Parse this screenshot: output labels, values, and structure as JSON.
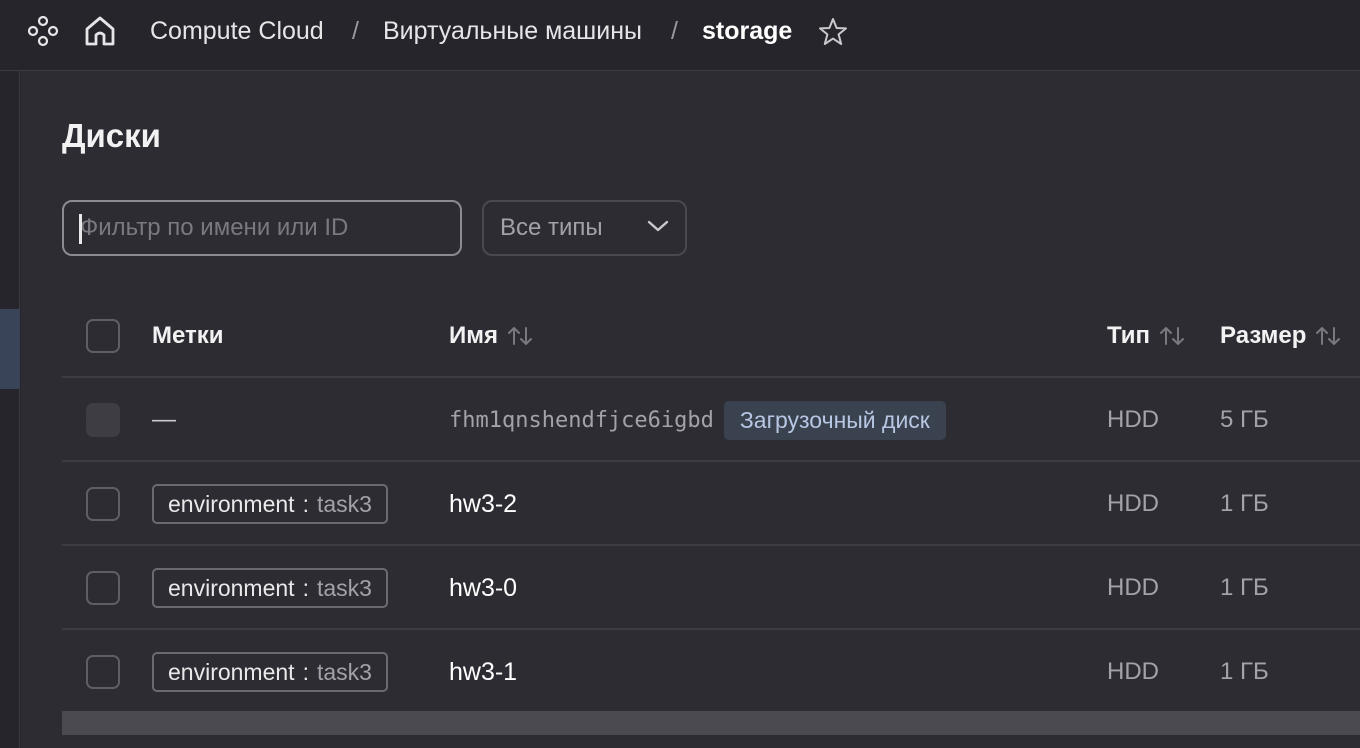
{
  "breadcrumbs": {
    "service": "Compute Cloud",
    "section": "Виртуальные машины",
    "current": "storage",
    "separator": "/"
  },
  "page": {
    "title": "Диски"
  },
  "filters": {
    "search_placeholder": "Фильтр по имени или ID",
    "search_value": "",
    "type_select": "Все типы"
  },
  "table": {
    "columns": {
      "labels": "Метки",
      "name": "Имя",
      "type": "Тип",
      "size": "Размер"
    },
    "rows": [
      {
        "label": "—",
        "name": "fhm1qnshendfjce6igbd",
        "badge": "Загрузочный диск",
        "type": "HDD",
        "size": "5 ГБ",
        "selectable": false
      },
      {
        "tag_key": "environment",
        "tag_sep": ":",
        "tag_value": "task3",
        "name": "hw3-2",
        "type": "HDD",
        "size": "1 ГБ",
        "selectable": true
      },
      {
        "tag_key": "environment",
        "tag_sep": ":",
        "tag_value": "task3",
        "name": "hw3-0",
        "type": "HDD",
        "size": "1 ГБ",
        "selectable": true
      },
      {
        "tag_key": "environment",
        "tag_sep": ":",
        "tag_value": "task3",
        "name": "hw3-1",
        "type": "HDD",
        "size": "1 ГБ",
        "selectable": true
      }
    ]
  },
  "icons": {
    "services": "services-icon",
    "home": "home-icon",
    "favorite": "star-icon",
    "dropdown": "chevron-down-icon",
    "sort": "sort-icon"
  },
  "colors": {
    "background": "#26252b",
    "panel": "#2d2c33",
    "badge_bg": "#3a4250",
    "badge_text": "#b7c6e2"
  }
}
